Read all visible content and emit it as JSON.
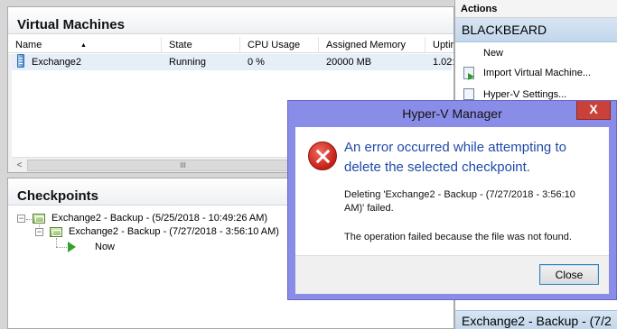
{
  "vm_pane": {
    "title": "Virtual Machines",
    "columns": [
      "Name",
      "State",
      "CPU Usage",
      "Assigned Memory",
      "Uptir"
    ],
    "rows": [
      {
        "name": "Exchange2",
        "state": "Running",
        "cpu": "0 %",
        "memory": "20000 MB",
        "uptime": "1.02:"
      }
    ],
    "scroll_left": "<",
    "scroll_thumb": "III"
  },
  "checkpoints_pane": {
    "title": "Checkpoints",
    "items": [
      {
        "label": "Exchange2 - Backup - (5/25/2018 - 10:49:26 AM)"
      },
      {
        "label": "Exchange2 - Backup - (7/27/2018 - 3:56:10 AM)"
      },
      {
        "label": "Now"
      }
    ]
  },
  "actions": {
    "header": "Actions",
    "group": "BLACKBEARD",
    "items": [
      "New",
      "Import Virtual Machine...",
      "Hyper-V Settings..."
    ],
    "bottom_group": "Exchange2 - Backup - (7/2"
  },
  "dialog": {
    "title": "Hyper-V Manager",
    "close_glyph": "X",
    "main_message": "An error occurred while attempting to delete the selected checkpoint.",
    "detail": "Deleting 'Exchange2 - Backup - (7/27/2018 - 3:56:10 AM)' failed.",
    "reason": "The operation failed because the file was not found.",
    "close_button": "Close"
  },
  "colors": {
    "dialog_frame": "#8a8de8",
    "error_text": "#1f4aa8",
    "close_red": "#c9413a"
  }
}
